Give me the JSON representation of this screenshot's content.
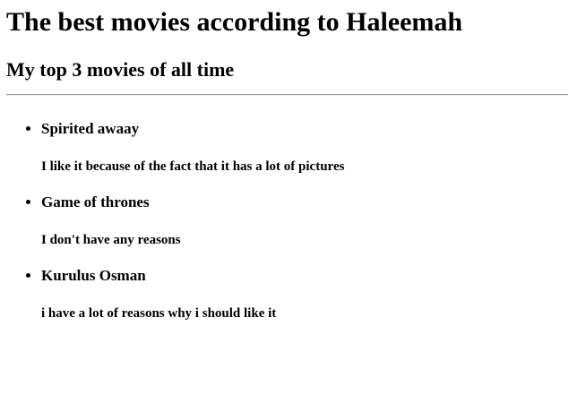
{
  "page": {
    "heading": "The best movies according to Haleemah",
    "subheading": "My top 3 movies of all time"
  },
  "movies": [
    {
      "title": "Spirited awaay",
      "reason": "I like it because of the fact that it has a lot of pictures"
    },
    {
      "title": "Game of thrones",
      "reason": "I don't have any reasons"
    },
    {
      "title": "Kurulus Osman",
      "reason": "i have a lot of reasons why i should like it"
    }
  ]
}
